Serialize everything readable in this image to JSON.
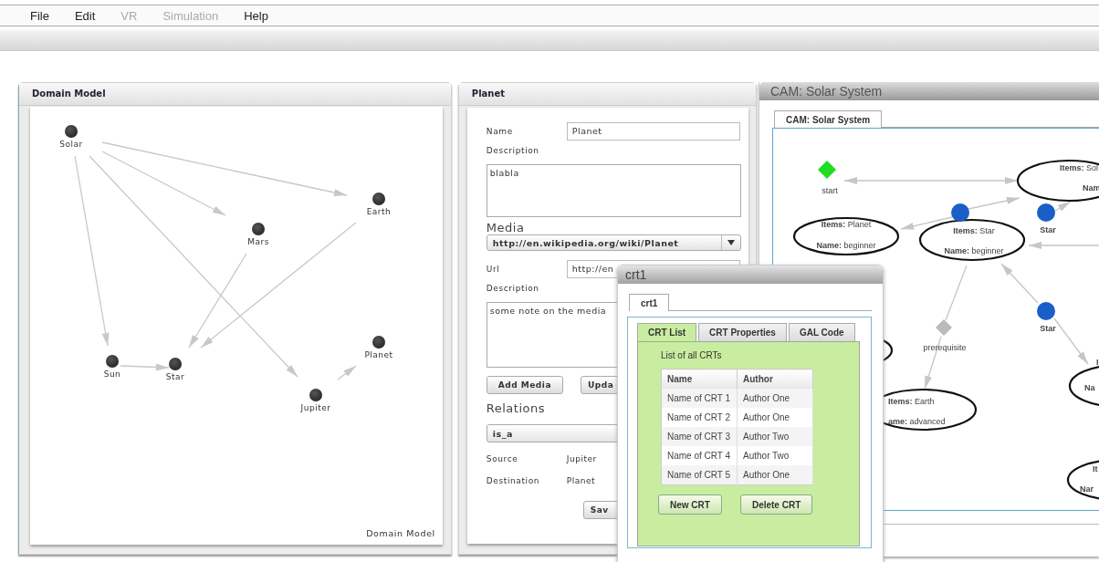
{
  "menu": [
    {
      "label": "File",
      "disabled": false
    },
    {
      "label": "Edit",
      "disabled": false
    },
    {
      "label": "VR",
      "disabled": true
    },
    {
      "label": "Simulation",
      "disabled": true
    },
    {
      "label": "Help",
      "disabled": false
    }
  ],
  "domain_model": {
    "title": "Domain Model",
    "nodes": [
      {
        "label": "Solar"
      },
      {
        "label": "Earth"
      },
      {
        "label": "Mars"
      },
      {
        "label": "Sun"
      },
      {
        "label": "Star"
      },
      {
        "label": "Planet"
      },
      {
        "label": "Jupiter"
      }
    ],
    "caption": "Domain Model"
  },
  "concept_editor": {
    "title": "Planet",
    "name_label": "Name",
    "name_value": "Planet",
    "description_label": "Description",
    "description_value": "blabla",
    "media_heading": "Media",
    "media_select": "http://en.wikipedia.org/wiki/Planet",
    "url_label": "Url",
    "url_value": "http://en",
    "media_description_label": "Description",
    "media_description_value": "some note on the media",
    "buttons": [
      "Add Media",
      "Upda"
    ],
    "relations_heading": "Relations",
    "relation_select": "is_a",
    "source_label": "Source",
    "source_value": "Jupiter",
    "destination_label": "Destination",
    "destination_value": "Planet",
    "save_button": "Sav"
  },
  "cam_window": {
    "title": "CAM: Solar System",
    "tab": "CAM: Solar System",
    "elements": [
      {
        "kind": "start",
        "label": "start"
      },
      {
        "kind": "state",
        "lines": [
          {
            "key": "Items:",
            "value": "Sol"
          },
          {
            "key": "Nam"
          }
        ]
      },
      {
        "kind": "state",
        "lines": [
          {
            "key": "Items:",
            "value": "Planet"
          },
          {
            "key": "Name:",
            "value": "beginner"
          }
        ]
      },
      {
        "kind": "state",
        "lines": [
          {
            "key": "Items:",
            "value": "Star"
          },
          {
            "key": "Name:",
            "value": "beginner"
          }
        ]
      },
      {
        "kind": "state",
        "lines": [
          {
            "key": "Items:",
            "value": "Earth"
          },
          {
            "key": "ame:",
            "value": "advanced"
          }
        ]
      },
      {
        "kind": "state"
      },
      {
        "kind": "state",
        "lines": [
          {
            "key": "I"
          },
          {
            "key": "Na"
          }
        ]
      },
      {
        "kind": "state",
        "lines": [
          {
            "key": "It"
          },
          {
            "key": "Nar"
          }
        ]
      },
      {
        "kind": "concept"
      },
      {
        "kind": "concept",
        "label": "Star"
      },
      {
        "kind": "concept",
        "label": "Star"
      },
      {
        "kind": "relation",
        "label": "prerequisite"
      }
    ]
  },
  "crt_window": {
    "title": "crt1",
    "tab": "crt1",
    "tabs": [
      {
        "label": "CRT List",
        "selected": true
      },
      {
        "label": "CRT Properties",
        "selected": false
      },
      {
        "label": "GAL Code",
        "selected": false
      }
    ],
    "caption": "List of all CRTs",
    "table": {
      "columns": [
        "Name",
        "Author"
      ],
      "rows": [
        [
          "Name of CRT 1",
          "Author One"
        ],
        [
          "Name of CRT 2",
          "Author One"
        ],
        [
          "Name of CRT 3",
          "Author Two"
        ],
        [
          "Name of CRT 4",
          "Author Two"
        ],
        [
          "Name of CRT 5",
          "Author One"
        ]
      ]
    },
    "buttons": [
      "New CRT",
      "Delete CRT"
    ]
  }
}
